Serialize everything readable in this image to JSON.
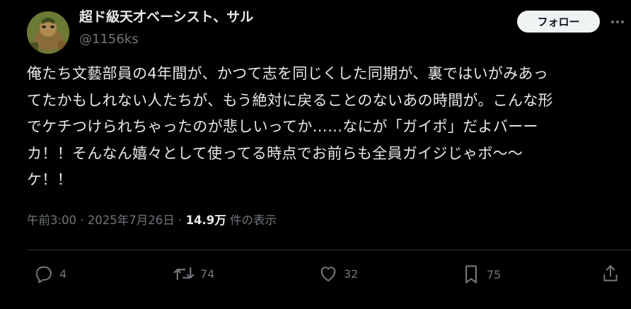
{
  "author": {
    "display_name": "超ド級天才ベーシスト、サル",
    "handle": "@1156ks"
  },
  "follow_label": "フォロー",
  "tweet": {
    "lines": [
      "俺たち文藝部員の4年間が、かつて志を同じくした同期が、裏ではいがみあっ",
      "てたかもしれない人たちが、もう絶対に戻ることのないあの時間が。こんな形",
      "でケチつけられちゃったのが悲しいってか……なにが「ガイポ」だよバーー",
      "カ！！そんなん嬉々として使ってる時点でお前らも全員ガイジじゃボ〜〜",
      "ケ！！"
    ]
  },
  "meta": {
    "time": "午前3:00",
    "separator": "·",
    "date": "2025年7月26日",
    "views_count": "14.9万",
    "views_label": "件の表示"
  },
  "actions": {
    "reply_count": "4",
    "repost_count": "74",
    "like_count": "32",
    "bookmark_count": "75"
  },
  "colors": {
    "background": "#000000",
    "text_primary": "#e7e9ea",
    "text_secondary": "#71767b",
    "divider": "#2f3336",
    "follow_button_bg": "#eff3f4"
  },
  "icons": [
    "more-icon",
    "reply-icon",
    "repost-icon",
    "like-icon",
    "bookmark-icon",
    "share-icon"
  ]
}
